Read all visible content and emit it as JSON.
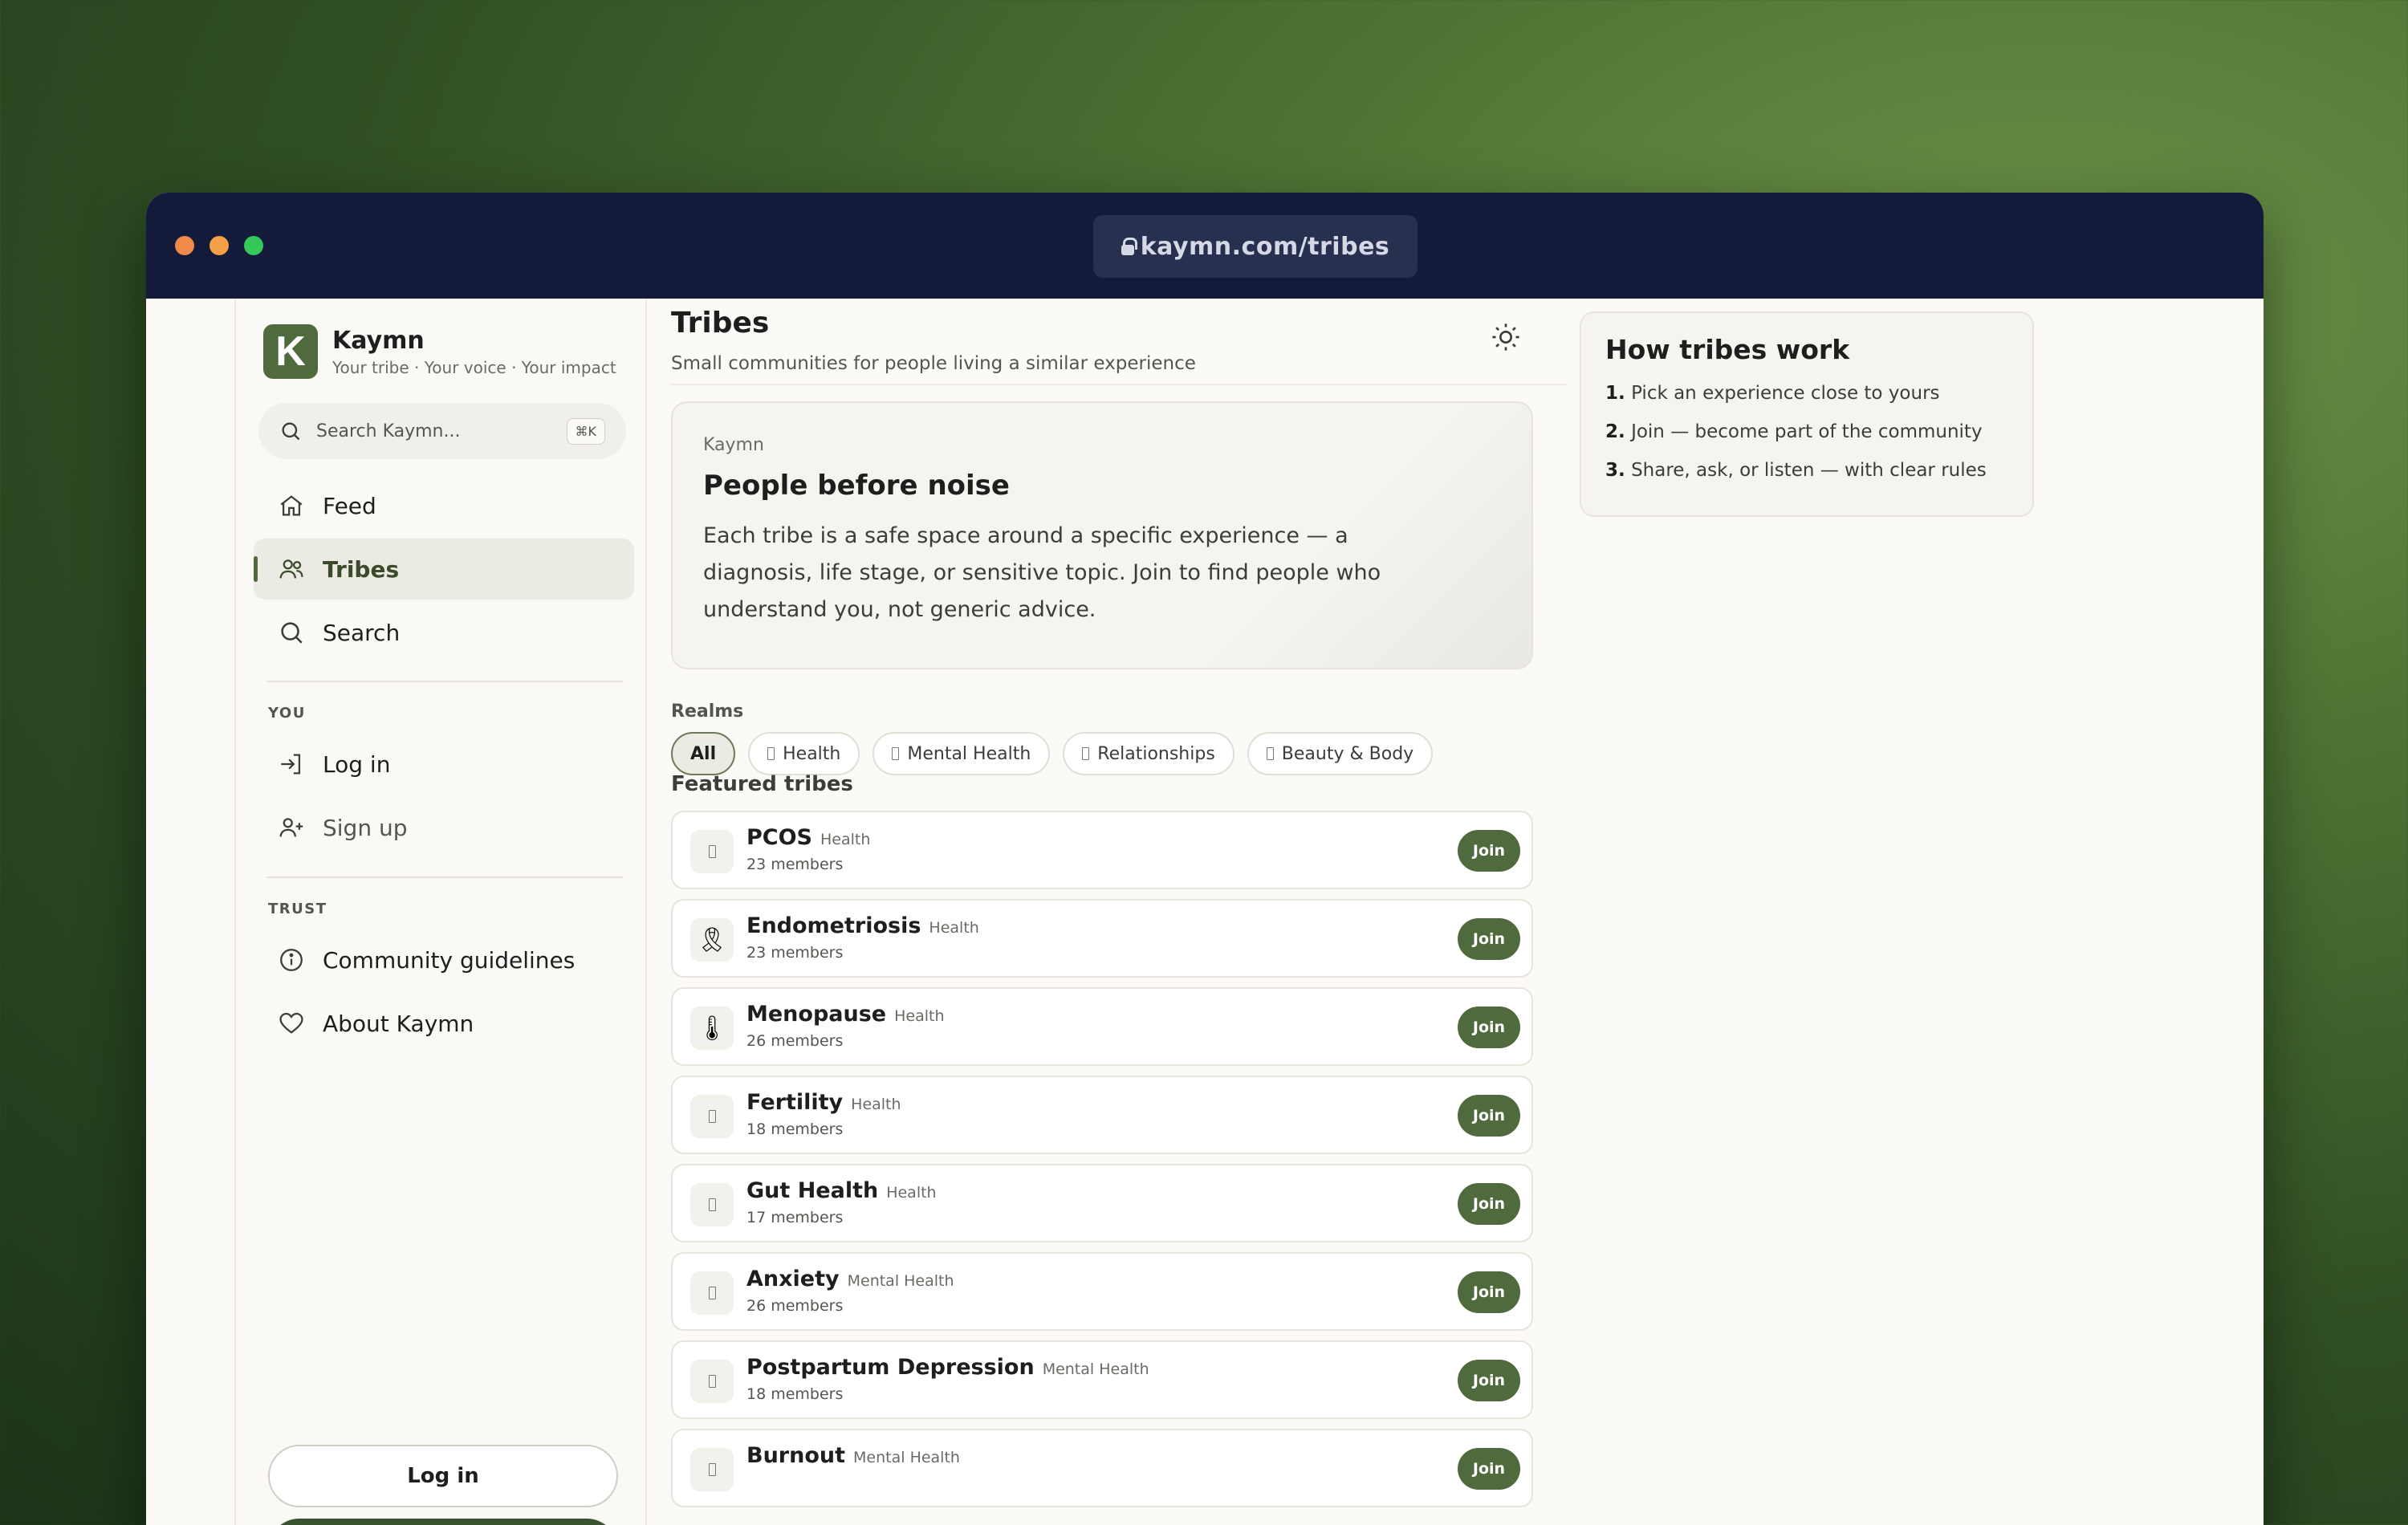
{
  "browser": {
    "url": "kaymn.com/tribes"
  },
  "brand": {
    "initial": "K",
    "name": "Kaymn",
    "tagline": "Your tribe · Your voice · Your impact"
  },
  "search": {
    "placeholder": "Search Kaymn...",
    "shortcut": "⌘K"
  },
  "nav": {
    "items": [
      {
        "label": "Feed",
        "icon": "home-icon",
        "active": false
      },
      {
        "label": "Tribes",
        "icon": "users-icon",
        "active": true
      },
      {
        "label": "Search",
        "icon": "search-icon",
        "active": false
      }
    ],
    "you_label": "YOU",
    "you_items": [
      {
        "label": "Log in",
        "icon": "login-icon"
      },
      {
        "label": "Sign up",
        "icon": "user-plus-icon"
      }
    ],
    "trust_label": "TRUST",
    "trust_items": [
      {
        "label": "Community guidelines",
        "icon": "info-icon"
      },
      {
        "label": "About Kaymn",
        "icon": "heart-icon"
      }
    ],
    "login_button": "Log in"
  },
  "header": {
    "title": "Tribes",
    "subtitle": "Small communities for people living a similar experience"
  },
  "hero": {
    "kicker": "Kaymn",
    "title": "People before noise",
    "body": "Each tribe is a safe space around a specific experience — a diagnosis, life stage, or sensitive topic. Join to find people who understand you, not generic advice."
  },
  "realms": {
    "label": "Realms",
    "chips": [
      "All",
      "Health",
      "Mental Health",
      "Relationships",
      "Beauty & Body"
    ]
  },
  "featured": {
    "label": "Featured tribes",
    "join_label": "Join",
    "tribes": [
      {
        "name": "PCOS",
        "realm": "Health",
        "members": "23 members",
        "icon": ""
      },
      {
        "name": "Endometriosis",
        "realm": "Health",
        "members": "23 members",
        "icon": "🎗"
      },
      {
        "name": "Menopause",
        "realm": "Health",
        "members": "26 members",
        "icon": "🌡"
      },
      {
        "name": "Fertility",
        "realm": "Health",
        "members": "18 members",
        "icon": ""
      },
      {
        "name": "Gut Health",
        "realm": "Health",
        "members": "17 members",
        "icon": ""
      },
      {
        "name": "Anxiety",
        "realm": "Mental Health",
        "members": "26 members",
        "icon": ""
      },
      {
        "name": "Postpartum Depression",
        "realm": "Mental Health",
        "members": "18 members",
        "icon": ""
      },
      {
        "name": "Burnout",
        "realm": "Mental Health",
        "members": "",
        "icon": ""
      }
    ]
  },
  "how_it_works": {
    "title": "How tribes work",
    "steps": [
      {
        "num": "1.",
        "text": "Pick an experience close to yours"
      },
      {
        "num": "2.",
        "text": "Join — become part of the community"
      },
      {
        "num": "3.",
        "text": "Share, ask, or listen — with clear rules"
      }
    ]
  }
}
